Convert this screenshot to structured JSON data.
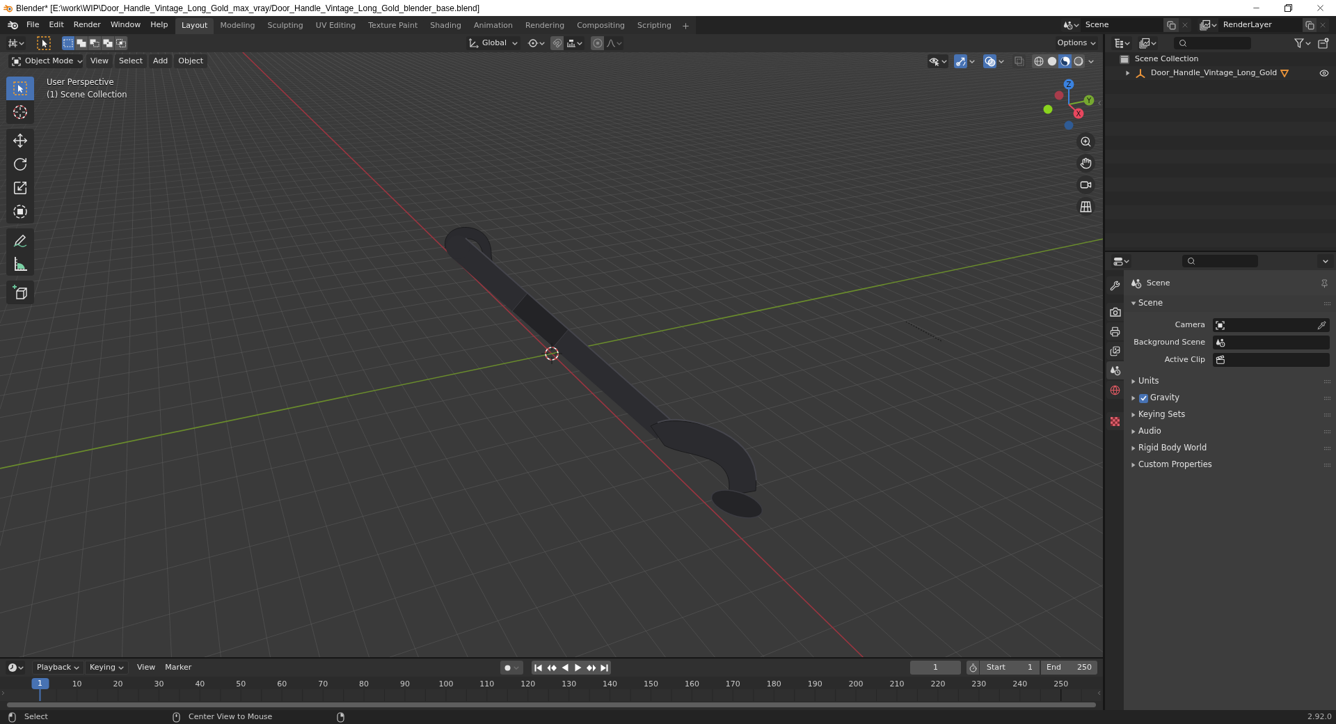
{
  "window": {
    "title": "Blender* [E:\\work\\WIP\\Door_Handle_Vintage_Long_Gold_max_vray/Door_Handle_Vintage_Long_Gold_blender_base.blend]"
  },
  "menu": [
    "File",
    "Edit",
    "Render",
    "Window",
    "Help"
  ],
  "workspaces": [
    {
      "label": "Layout",
      "selected": true
    },
    {
      "label": "Modeling",
      "selected": false
    },
    {
      "label": "Sculpting",
      "selected": false
    },
    {
      "label": "UV Editing",
      "selected": false
    },
    {
      "label": "Texture Paint",
      "selected": false
    },
    {
      "label": "Shading",
      "selected": false
    },
    {
      "label": "Animation",
      "selected": false
    },
    {
      "label": "Rendering",
      "selected": false
    },
    {
      "label": "Compositing",
      "selected": false
    },
    {
      "label": "Scripting",
      "selected": false
    }
  ],
  "scene_selector": {
    "value": "Scene"
  },
  "view_layer_selector": {
    "value": "RenderLayer"
  },
  "tool_header": {
    "selection_modes": [
      {
        "kind": "set",
        "selected": true
      },
      {
        "kind": "extend",
        "selected": false
      },
      {
        "kind": "subtract",
        "selected": false
      },
      {
        "kind": "invert",
        "selected": false
      },
      {
        "kind": "intersect",
        "selected": false
      }
    ],
    "orientation": "Global",
    "options": "Options"
  },
  "viewport": {
    "mode": "Object Mode",
    "menus": [
      "View",
      "Select",
      "Add",
      "Object"
    ],
    "toggles": [
      {
        "kind": "gizmos",
        "on": true
      },
      {
        "kind": "overlays",
        "on": true
      },
      {
        "kind": "xray",
        "on": false
      }
    ],
    "shading": [
      {
        "kind": "wireframe",
        "selected": false
      },
      {
        "kind": "solid",
        "selected": false
      },
      {
        "kind": "material",
        "selected": true
      },
      {
        "kind": "rendered",
        "selected": false
      }
    ],
    "info": [
      "User Perspective",
      "(1) Scene Collection"
    ],
    "tool_groups": [
      {
        "tools": [
          {
            "kind": "select_box",
            "selected": true
          },
          {
            "kind": "cursor",
            "selected": false
          }
        ]
      },
      {
        "tools": [
          {
            "kind": "move",
            "selected": false
          },
          {
            "kind": "rotate",
            "selected": false
          },
          {
            "kind": "scale",
            "selected": false
          },
          {
            "kind": "transform",
            "selected": false
          }
        ]
      },
      {
        "tools": [
          {
            "kind": "annotate",
            "selected": false
          },
          {
            "kind": "measure",
            "selected": false
          }
        ]
      },
      {
        "tools": [
          {
            "kind": "add_cube",
            "selected": false
          }
        ]
      }
    ],
    "gizmo_axes": [
      {
        "kind": "z",
        "label": "Z",
        "color": "#3a82e0"
      },
      {
        "kind": "neg_x",
        "color": "#a83c4b"
      },
      {
        "kind": "y",
        "label": "Y",
        "color": "#76a830"
      },
      {
        "kind": "neg_y",
        "color": "#8ad41e"
      },
      {
        "kind": "x",
        "label": "X",
        "color": "#e8475e"
      },
      {
        "kind": "neg_z",
        "color": "#2f5b94"
      }
    ]
  },
  "outliner": {
    "root": "Scene Collection",
    "items": [
      {
        "label": "Door_Handle_Vintage_Long_Gold",
        "expanded": false,
        "visible": true
      }
    ]
  },
  "properties": {
    "tabs": [
      {
        "kind": "tool",
        "selected": false
      },
      {
        "kind": "render",
        "selected": false
      },
      {
        "kind": "output",
        "selected": false
      },
      {
        "kind": "view_layer",
        "selected": false
      },
      {
        "kind": "scene",
        "selected": true
      },
      {
        "kind": "world",
        "selected": false
      },
      {
        "kind": "texture",
        "selected": false
      }
    ],
    "context": "Scene",
    "panels": [
      {
        "kind": "section",
        "title": "Scene",
        "expanded": true,
        "fields": [
          {
            "kind": "camera",
            "label": "Camera"
          },
          {
            "kind": "scene",
            "label": "Background Scene"
          },
          {
            "kind": "clip",
            "label": "Active Clip"
          }
        ]
      },
      {
        "kind": "section",
        "title": "Units",
        "expanded": false
      },
      {
        "kind": "toggle",
        "title": "Gravity",
        "expanded": false,
        "checked": true
      },
      {
        "kind": "section",
        "title": "Keying Sets",
        "expanded": false
      },
      {
        "kind": "section",
        "title": "Audio",
        "expanded": false
      },
      {
        "kind": "section",
        "title": "Rigid Body World",
        "expanded": false
      },
      {
        "kind": "section",
        "title": "Custom Properties",
        "expanded": false
      }
    ]
  },
  "timeline": {
    "menus": [
      "Playback",
      "Keying",
      "View",
      "Marker"
    ],
    "current_frame": "1",
    "start_label": "Start",
    "start": "1",
    "end_label": "End",
    "end": "250",
    "playhead": "1",
    "frame_labels": [
      "10",
      "20",
      "30",
      "40",
      "50",
      "60",
      "70",
      "80",
      "90",
      "100",
      "110",
      "120",
      "130",
      "140",
      "150",
      "160",
      "170",
      "180",
      "190",
      "200",
      "210",
      "220",
      "230",
      "240",
      "250"
    ]
  },
  "status_bar": {
    "hints": [
      {
        "kind": "left",
        "label": "Select"
      },
      {
        "kind": "middle",
        "label": "Center View to Mouse"
      },
      {
        "kind": "right"
      }
    ],
    "version": "2.92.0"
  }
}
